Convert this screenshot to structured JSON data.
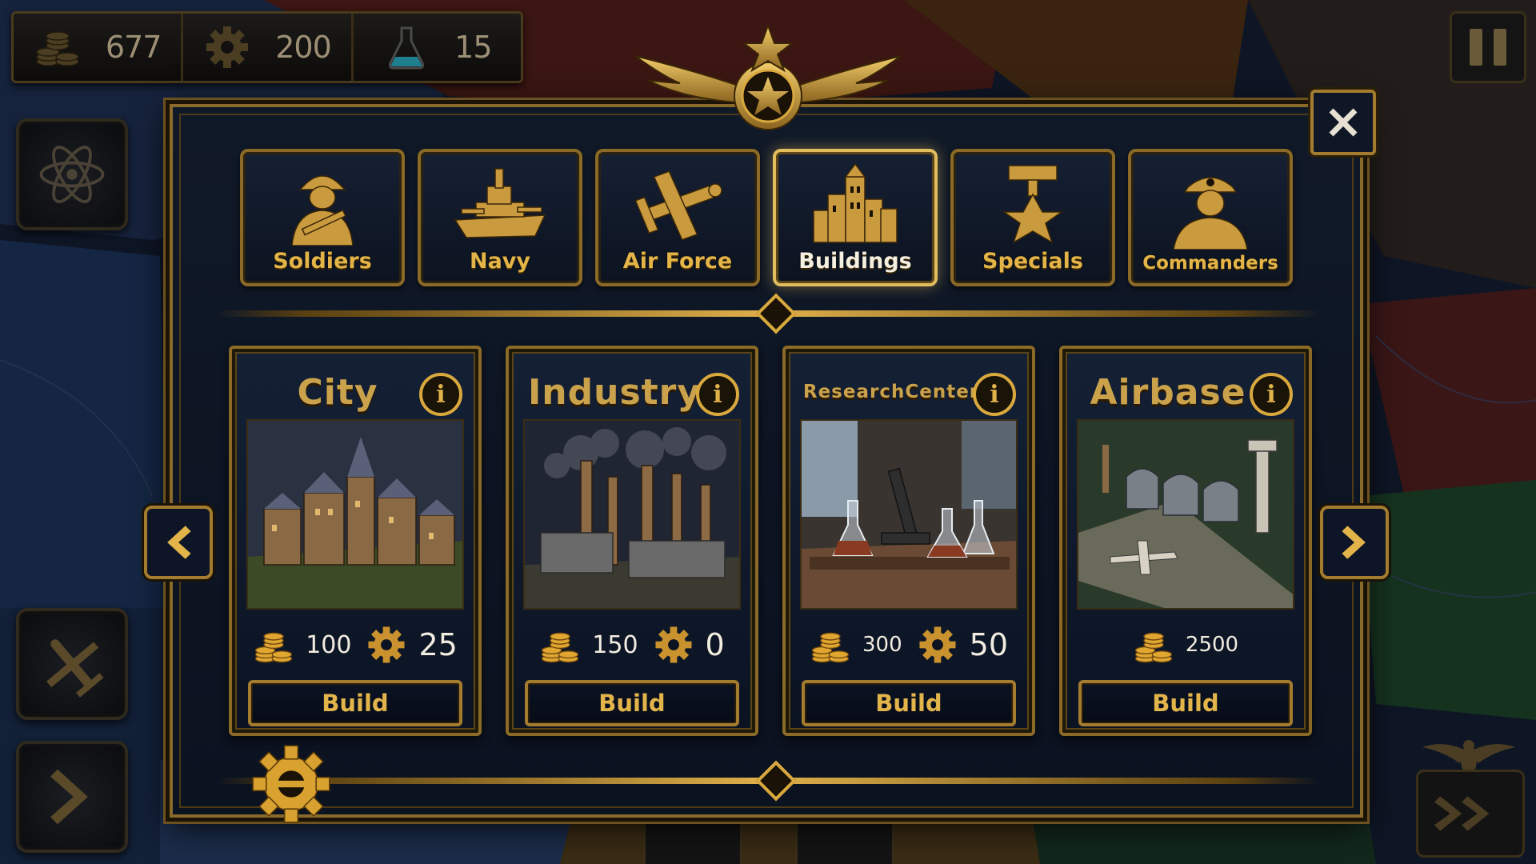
{
  "resources": {
    "coins": "677",
    "production": "200",
    "research": "15"
  },
  "icons": {
    "coins": "coin-stack-icon",
    "production": "gear-icon",
    "research": "flask-icon",
    "atom": "atom-icon",
    "aircraft": "plane-icon",
    "next_turn": "chevron-right-icon",
    "pause": "pause-icon",
    "close": "close-icon",
    "fast_forward": "double-chevron-icon"
  },
  "tabs": [
    {
      "label": "Soldiers",
      "icon": "soldier-icon",
      "active": false
    },
    {
      "label": "Navy",
      "icon": "battleship-icon",
      "active": false
    },
    {
      "label": "Air Force",
      "icon": "plane-icon",
      "active": false
    },
    {
      "label": "Buildings",
      "icon": "buildings-icon",
      "active": true
    },
    {
      "label": "Specials",
      "icon": "medal-icon",
      "active": false
    },
    {
      "label": "Commanders",
      "icon": "commander-icon",
      "active": false
    }
  ],
  "cards": [
    {
      "title": "City",
      "info": "i",
      "coins": "100",
      "gears": "25",
      "build": "Build"
    },
    {
      "title": "Industry",
      "info": "i",
      "coins": "150",
      "gears": "0",
      "build": "Build"
    },
    {
      "title_line1": "Research",
      "title_line2": "Center",
      "info": "i",
      "coins": "300",
      "gears": "50",
      "build": "Build"
    },
    {
      "title": "Airbase",
      "info": "i",
      "coins": "2500",
      "build": "Build"
    }
  ],
  "colors": {
    "gold": "#d9a93e",
    "panel": "#0b1220",
    "frame": "#8b6a28",
    "active_tab_glow": "#e2bd5e"
  }
}
